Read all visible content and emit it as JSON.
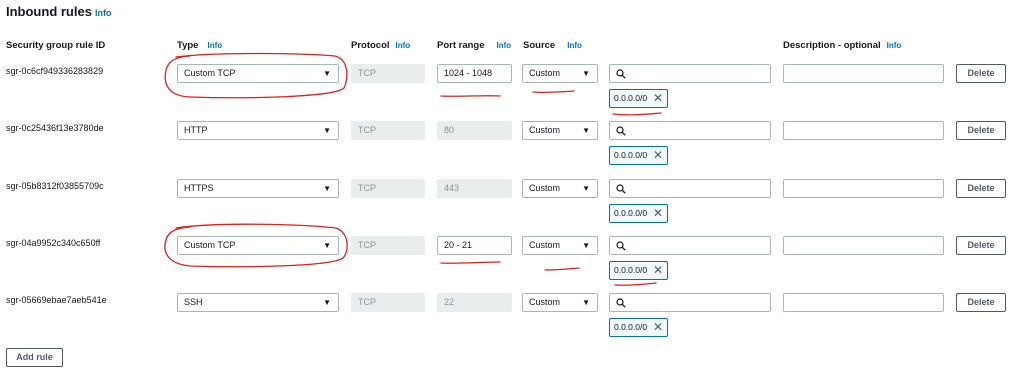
{
  "header": {
    "title": "Inbound rules",
    "info": "Info"
  },
  "columns": {
    "rule_id": "Security group rule ID",
    "type": "Type",
    "protocol": "Protocol",
    "port_range": "Port range",
    "source": "Source",
    "description": "Description - optional",
    "info": "Info"
  },
  "rules": [
    {
      "id": "sgr-0c6cf949336283829",
      "type": "Custom TCP",
      "protocol": "TCP",
      "port_range": "1024 - 1048",
      "port_editable": true,
      "source": "Custom",
      "cidr": "0.0.0.0/0",
      "description": "",
      "delete": "Delete"
    },
    {
      "id": "sgr-0c25436f13e3780de",
      "type": "HTTP",
      "protocol": "TCP",
      "port_range": "80",
      "port_editable": false,
      "source": "Custom",
      "cidr": "0.0.0.0/0",
      "description": "",
      "delete": "Delete"
    },
    {
      "id": "sgr-05b8312f03855709c",
      "type": "HTTPS",
      "protocol": "TCP",
      "port_range": "443",
      "port_editable": false,
      "source": "Custom",
      "cidr": "0.0.0.0/0",
      "description": "",
      "delete": "Delete"
    },
    {
      "id": "sgr-04a9952c340c650ff",
      "type": "Custom TCP",
      "protocol": "TCP",
      "port_range": "20 - 21",
      "port_editable": true,
      "source": "Custom",
      "cidr": "0.0.0.0/0",
      "description": "",
      "delete": "Delete"
    },
    {
      "id": "sgr-05669ebae7aeb541e",
      "type": "SSH",
      "protocol": "TCP",
      "port_range": "22",
      "port_editable": false,
      "source": "Custom",
      "cidr": "0.0.0.0/0",
      "description": "",
      "delete": "Delete"
    }
  ],
  "footer": {
    "add_rule": "Add rule"
  },
  "colors": {
    "link": "#0073bb",
    "annotation": "#e0201b",
    "border": "#aab7b8",
    "disabled_bg": "#eaeded"
  }
}
